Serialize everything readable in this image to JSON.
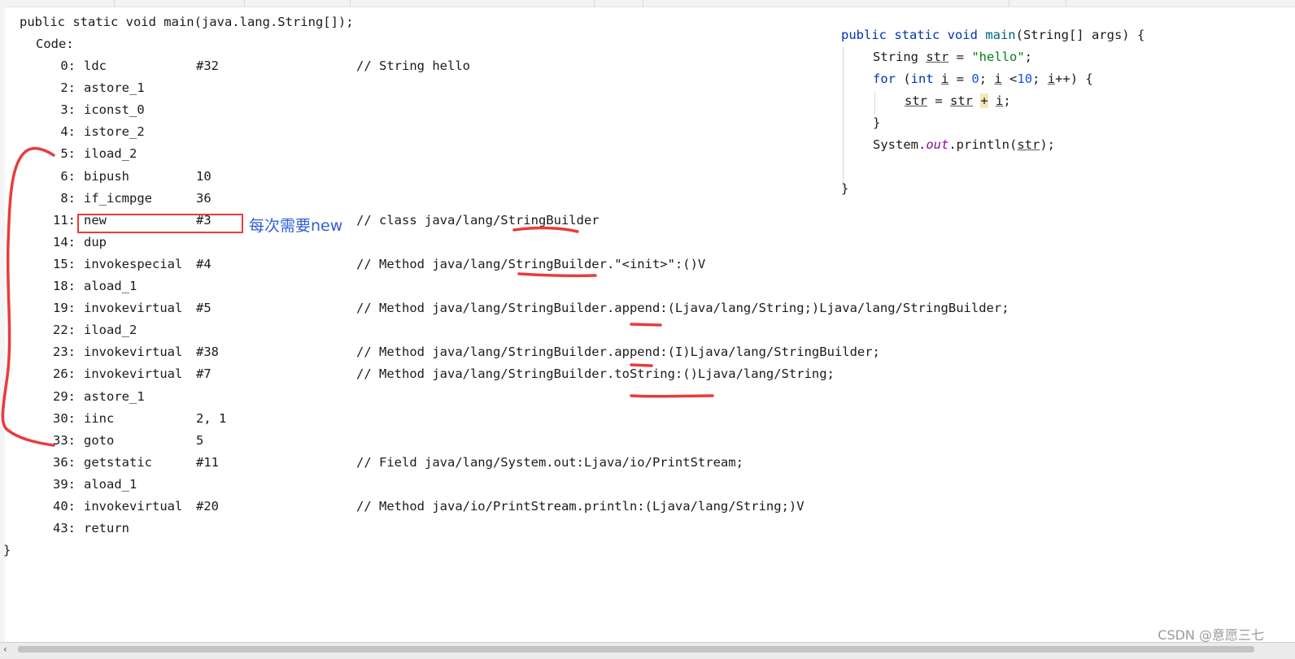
{
  "bytecode": {
    "header": "public static void main(java.lang.String[]);",
    "code_label": "Code:",
    "instructions": [
      {
        "offset": "0:",
        "op": "ldc",
        "arg": "#32",
        "comment": "// String hello"
      },
      {
        "offset": "2:",
        "op": "astore_1",
        "arg": "",
        "comment": ""
      },
      {
        "offset": "3:",
        "op": "iconst_0",
        "arg": "",
        "comment": ""
      },
      {
        "offset": "4:",
        "op": "istore_2",
        "arg": "",
        "comment": ""
      },
      {
        "offset": "5:",
        "op": "iload_2",
        "arg": "",
        "comment": ""
      },
      {
        "offset": "6:",
        "op": "bipush",
        "arg": "10",
        "comment": ""
      },
      {
        "offset": "8:",
        "op": "if_icmpge",
        "arg": "36",
        "comment": ""
      },
      {
        "offset": "11:",
        "op": "new",
        "arg": "#3",
        "comment": "// class java/lang/StringBuilder"
      },
      {
        "offset": "14:",
        "op": "dup",
        "arg": "",
        "comment": ""
      },
      {
        "offset": "15:",
        "op": "invokespecial",
        "arg": "#4",
        "comment": "// Method java/lang/StringBuilder.\"<init>\":()V"
      },
      {
        "offset": "18:",
        "op": "aload_1",
        "arg": "",
        "comment": ""
      },
      {
        "offset": "19:",
        "op": "invokevirtual",
        "arg": "#5",
        "comment": "// Method java/lang/StringBuilder.append:(Ljava/lang/String;)Ljava/lang/StringBuilder;"
      },
      {
        "offset": "22:",
        "op": "iload_2",
        "arg": "",
        "comment": ""
      },
      {
        "offset": "23:",
        "op": "invokevirtual",
        "arg": "#38",
        "comment": "// Method java/lang/StringBuilder.append:(I)Ljava/lang/StringBuilder;"
      },
      {
        "offset": "26:",
        "op": "invokevirtual",
        "arg": "#7",
        "comment": "// Method java/lang/StringBuilder.toString:()Ljava/lang/String;"
      },
      {
        "offset": "29:",
        "op": "astore_1",
        "arg": "",
        "comment": ""
      },
      {
        "offset": "30:",
        "op": "iinc",
        "arg": "2, 1",
        "comment": ""
      },
      {
        "offset": "33:",
        "op": "goto",
        "arg": "5",
        "comment": ""
      },
      {
        "offset": "36:",
        "op": "getstatic",
        "arg": "#11",
        "comment": "// Field java/lang/System.out:Ljava/io/PrintStream;"
      },
      {
        "offset": "39:",
        "op": "aload_1",
        "arg": "",
        "comment": ""
      },
      {
        "offset": "40:",
        "op": "invokevirtual",
        "arg": "#20",
        "comment": "// Method java/io/PrintStream.println:(Ljava/lang/String;)V"
      },
      {
        "offset": "43:",
        "op": "return",
        "arg": "",
        "comment": ""
      }
    ],
    "closing_brace": "}"
  },
  "annotation": {
    "note": "每次需要new",
    "highlight_color": "#ea3b3b",
    "note_color": "#2f5fd6"
  },
  "source": {
    "l1": {
      "kw1": "public static void ",
      "fn": "main",
      "rest": "(String[] args) {"
    },
    "l2": {
      "t1": "String ",
      "var": "str",
      "t2": " = ",
      "str": "\"hello\"",
      "t3": ";"
    },
    "l3": {
      "kw": "for",
      "t1": " (",
      "kw2": "int",
      "t2": " ",
      "v1": "i",
      "t3": " = ",
      "n0": "0",
      "t4": "; ",
      "v2": "i",
      "t5": " <",
      "n10": "10",
      "t6": "; ",
      "v3": "i",
      "t7": "++) {"
    },
    "l4": {
      "v1": "str",
      "t1": " = ",
      "v2": "str",
      "t2": " ",
      "plus": "+",
      "t3": " ",
      "v3": "i",
      "t4": ";"
    },
    "l5": "}",
    "l6": {
      "t1": "System.",
      "out": "out",
      "t2": ".println(",
      "v": "str",
      "t3": ");"
    },
    "l7": "}"
  },
  "watermark": "CSDN @意愿三七",
  "scrollbar": {
    "arrow_icon": "left-arrow",
    "arrow_glyph": "‹"
  }
}
